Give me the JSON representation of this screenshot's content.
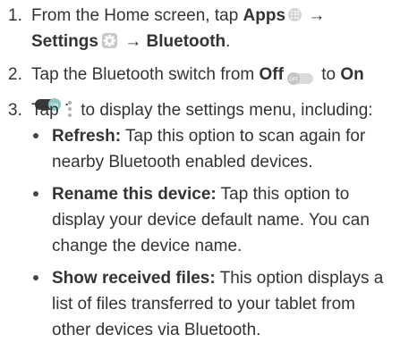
{
  "steps": [
    {
      "number": "1.",
      "text_1": "From the Home screen, tap ",
      "apps_label": "Apps",
      "arrow_1": " → ",
      "settings_label": "Settings",
      "arrow_2": " → ",
      "bluetooth_label": "Bluetooth",
      "end": "."
    },
    {
      "number": "2.",
      "text_1": "Tap the Bluetooth switch from ",
      "off_label": "Off",
      "off_switch_text": "OFF",
      "text_2": " to ",
      "on_label": "On",
      "on_switch_text": "ON",
      "end": "."
    },
    {
      "number": "3.",
      "text_1": "Tap ",
      "text_2": " to display the settings menu, including:",
      "options": [
        {
          "term": "Refresh:",
          "description": " Tap this option to scan again for nearby Bluetooth enabled devices."
        },
        {
          "term": "Rename this device:",
          "description": " Tap this option to display your device default name. You can change the device name."
        },
        {
          "term": "Show received files:",
          "description": " This option displays a list of files transferred to your tablet from other devices via Bluetooth."
        }
      ]
    }
  ],
  "icons": {
    "apps": "apps-icon",
    "settings": "settings-gear-icon",
    "switch_off": "toggle-off-icon",
    "switch_on": "toggle-on-icon",
    "more": "more-vertical-icon"
  },
  "colors": {
    "text": "#333333",
    "icon_gray": "#c8c8c8",
    "switch_on": "#3a3a3a",
    "switch_on_knob": "#8ec7c2"
  }
}
